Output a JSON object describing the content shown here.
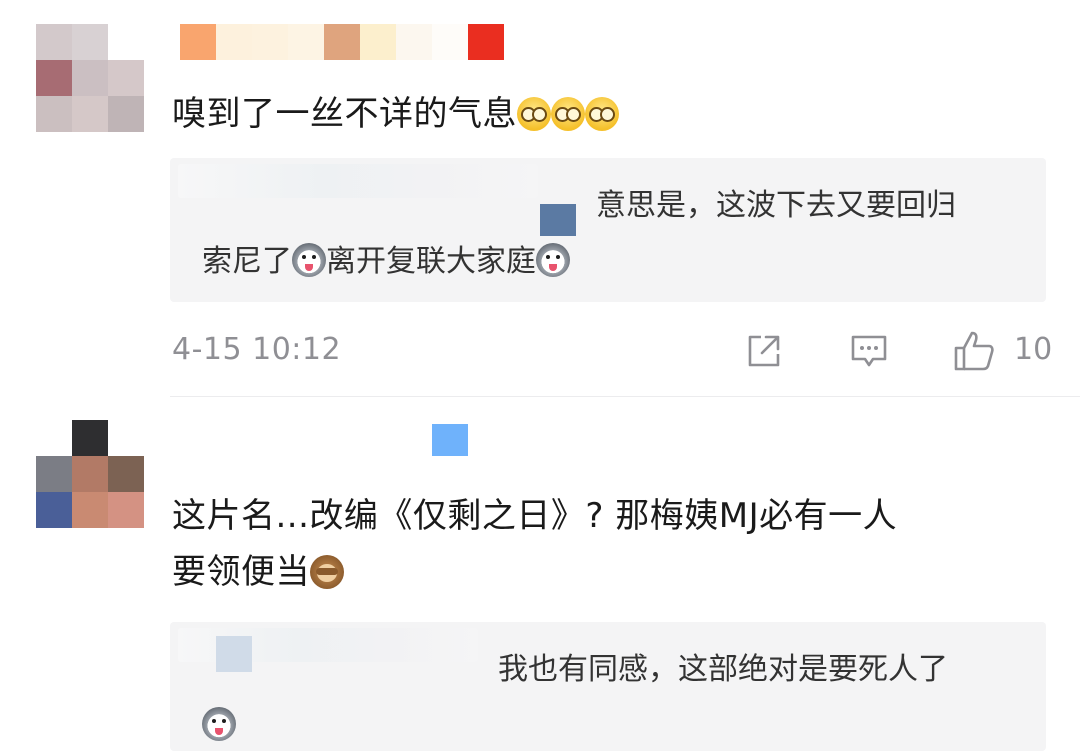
{
  "comments": [
    {
      "text": "嗅到了一丝不详的气息",
      "emoji_suffix": [
        "glasses-emoji",
        "glasses-emoji",
        "glasses-emoji"
      ],
      "reply": {
        "line1": "意思是，这波下去又要回归",
        "line2_a": "索尼了",
        "line2_b": "离开复联大家庭"
      },
      "timestamp": "4-15 10:12",
      "like_count": "10"
    },
    {
      "text_line1": "这片名...改编《仅剩之日》? 那梅姨MJ必有一人",
      "text_line2": "要领便当",
      "reply": {
        "line1": "我也有同感，这部绝对是要死人了"
      }
    }
  ],
  "icons": {
    "share": "share-icon",
    "comment": "comment-icon",
    "like": "thumbs-up-icon"
  },
  "colors": {
    "timestamp": "#8f8f94",
    "reply_bg": "#f4f4f5",
    "text": "#1a1a1a"
  }
}
